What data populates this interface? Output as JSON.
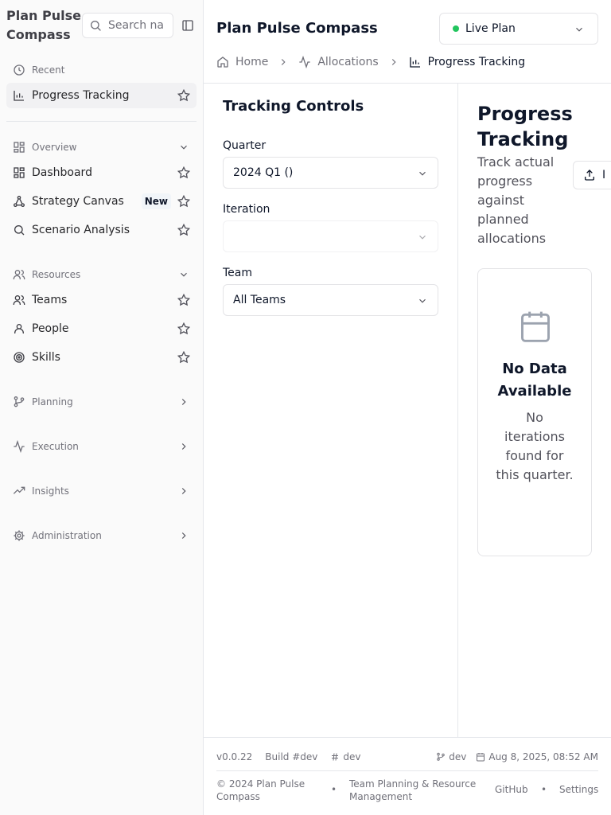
{
  "sidebar": {
    "app_title": "Plan Pulse Compass",
    "search_placeholder": "Search na",
    "recent_label": "Recent",
    "recent_items": [
      {
        "label": "Progress Tracking"
      }
    ],
    "overview": {
      "label": "Overview",
      "items": [
        {
          "label": "Dashboard"
        },
        {
          "label": "Strategy Canvas",
          "badge": "New"
        },
        {
          "label": "Scenario Analysis"
        }
      ]
    },
    "resources": {
      "label": "Resources",
      "items": [
        {
          "label": "Teams"
        },
        {
          "label": "People"
        },
        {
          "label": "Skills"
        }
      ]
    },
    "planning_label": "Planning",
    "execution_label": "Execution",
    "insights_label": "Insights",
    "administration_label": "Administration"
  },
  "header": {
    "title": "Plan Pulse Compass",
    "plan_select": "Live Plan",
    "plan_status_color": "#22c55e",
    "breadcrumb": [
      "Home",
      "Allocations",
      "Progress Tracking"
    ]
  },
  "controls": {
    "title": "Tracking Controls",
    "quarter_label": "Quarter",
    "quarter_value": "2024 Q1 ()",
    "iteration_label": "Iteration",
    "iteration_value": "",
    "team_label": "Team",
    "team_value": "All Teams"
  },
  "content": {
    "title": "Progress Tracking",
    "subtitle": "Track actual progress against planned allocations",
    "export_label": "I",
    "empty_title": "No Data Available",
    "empty_text": "No iterations found for this quarter."
  },
  "footer": {
    "version": "v0.0.22",
    "build": "Build #dev",
    "hash": "dev",
    "branch": "dev",
    "date": "Aug 8, 2025, 08:52 AM",
    "copyright": "© 2024 Plan Pulse Compass",
    "tagline": "Team Planning & Resource Management",
    "github": "GitHub",
    "settings": "Settings",
    "separator": "•"
  }
}
